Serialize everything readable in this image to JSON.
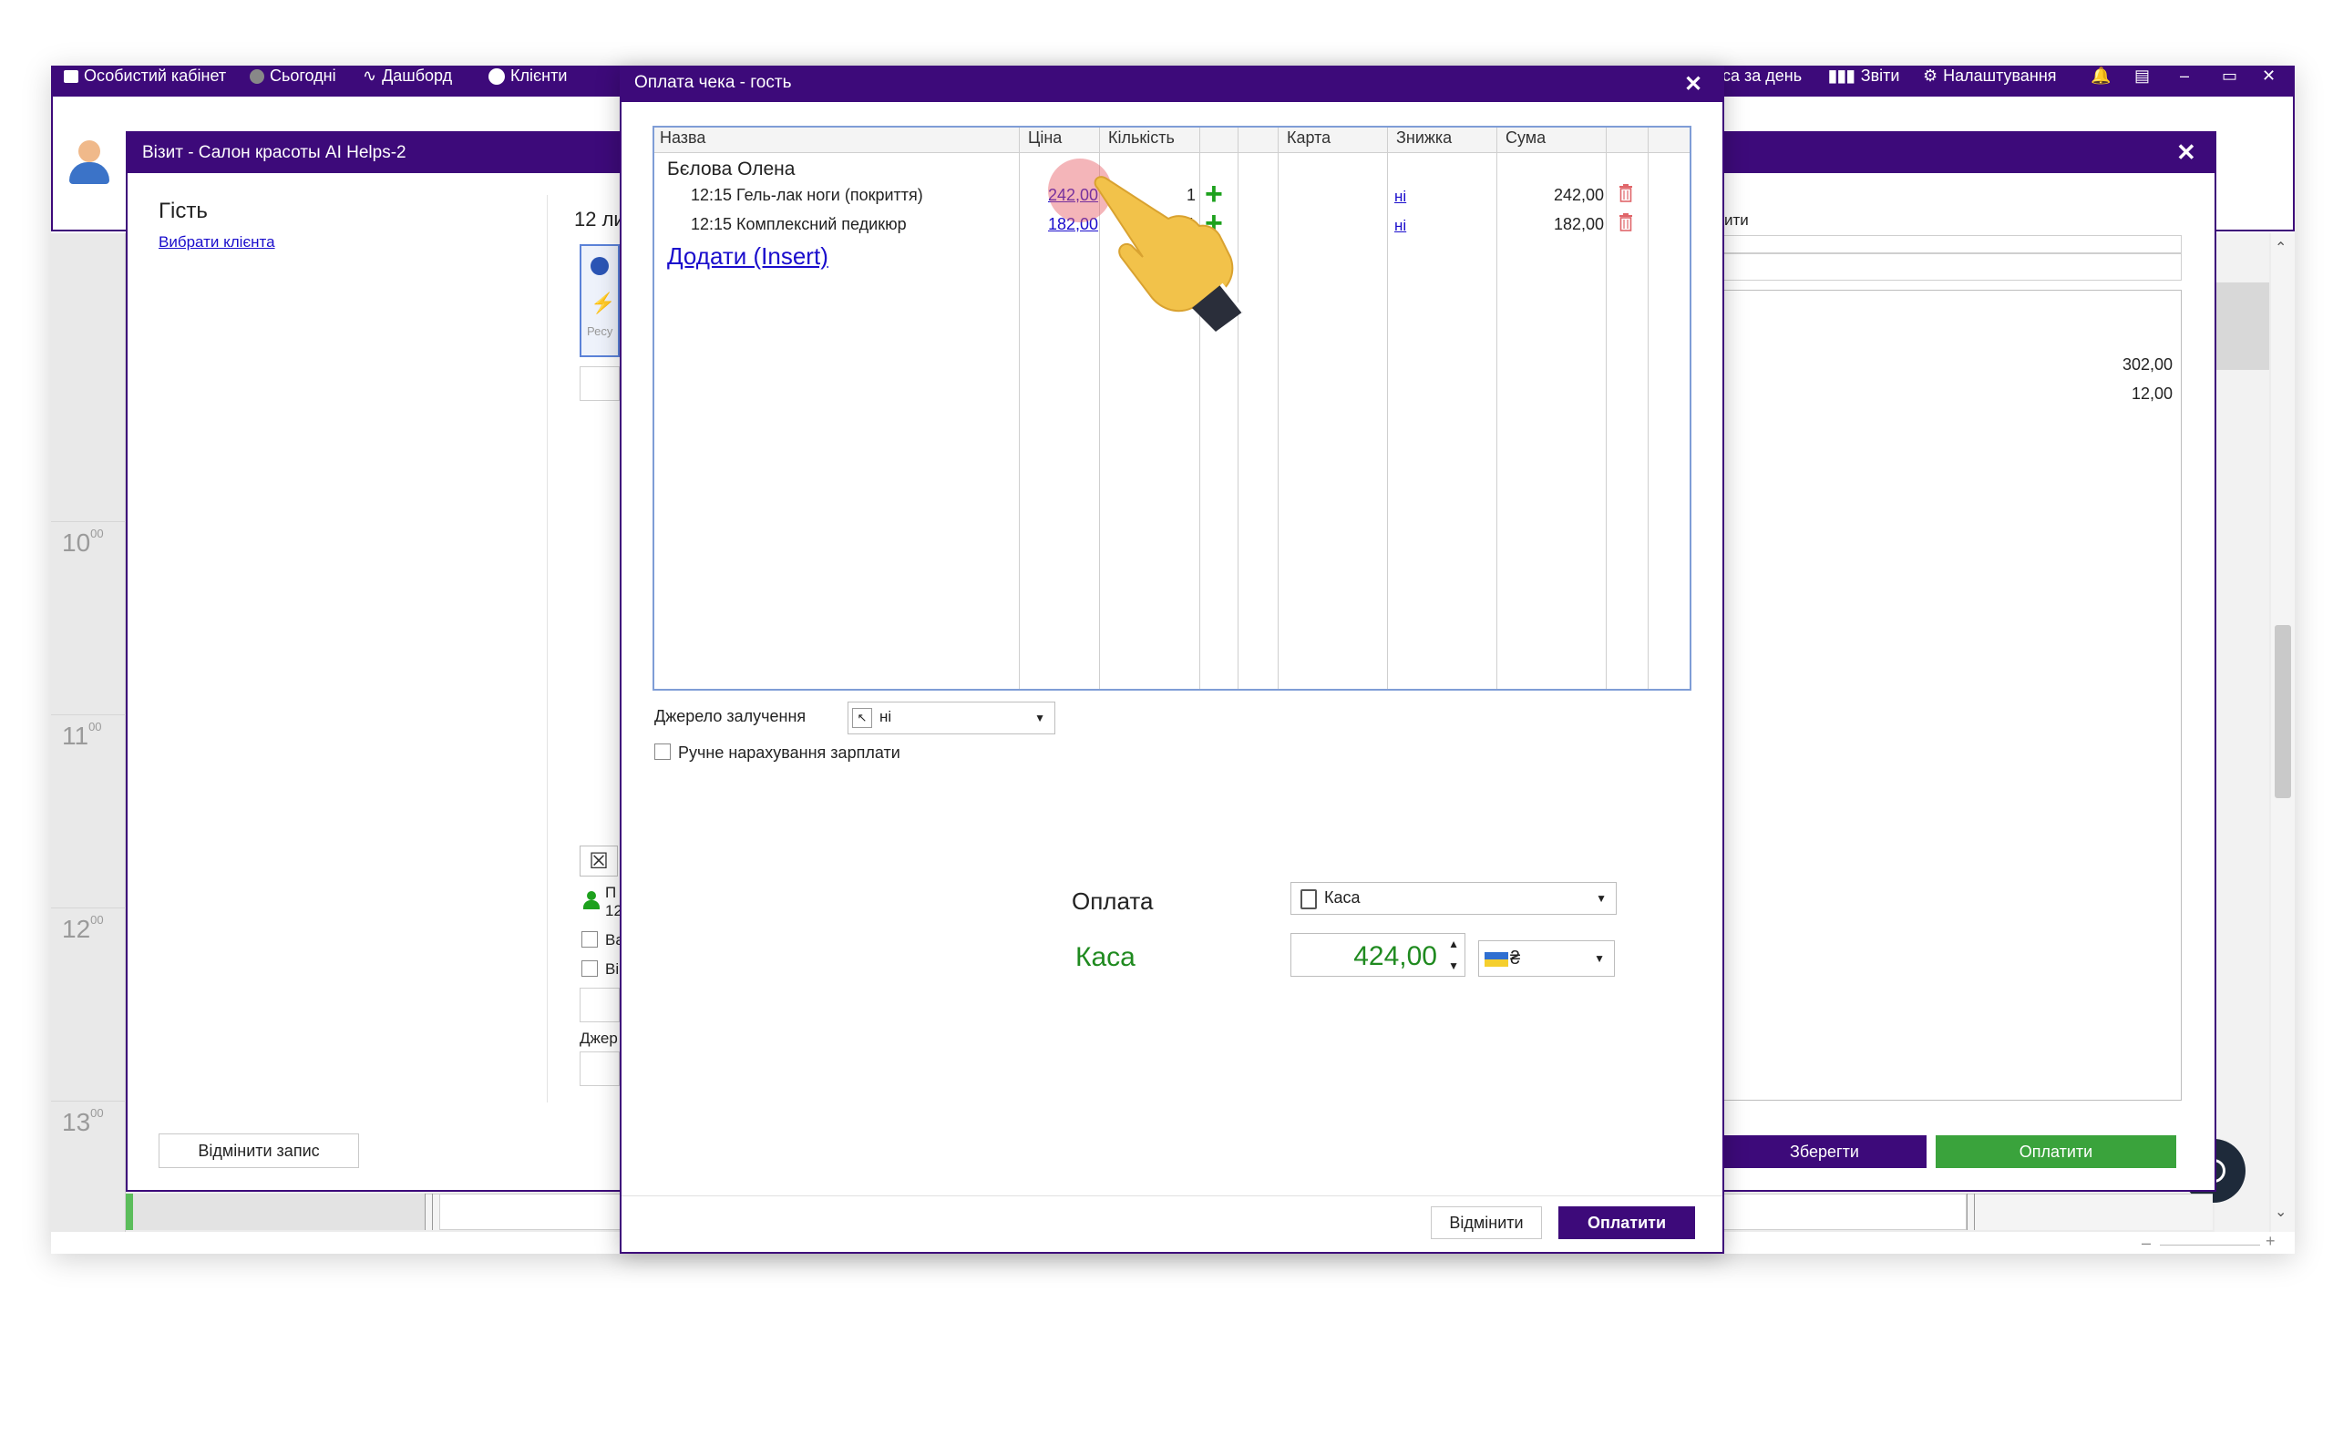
{
  "topnav": {
    "cabinet": "Особистий кабінет",
    "today": "Сьогодні",
    "dashboard": "Дашборд",
    "clients": "Клієнти",
    "day_cash": "са за день",
    "reports": "Звіти",
    "settings": "Налаштування"
  },
  "schedule": {
    "hours": [
      "10",
      "11",
      "12",
      "13"
    ],
    "minutes": "00"
  },
  "visit": {
    "title": "Візит - Салон красоты AI Helps-2",
    "guest_label": "Гість",
    "choose_client": "Вибрати клієнта",
    "date_partial": "12 ли",
    "cancel_button": "Відмінити запис",
    "save_button": "Зберегти",
    "pay_button": "Оплатити",
    "right_partial": "ити",
    "amount_1": "302,00",
    "amount_2": "12,00",
    "resource_partial": "Ресу",
    "source_partial": "Джер",
    "client_line1_partial": "П",
    "client_line2_partial": "12",
    "checkbox1_partial": "Ва",
    "checkbox2_partial": "Ві"
  },
  "dialog": {
    "title": "Оплата чека - гость",
    "columns": [
      "Назва",
      "Ціна",
      "Кількість",
      "",
      "Карта",
      "Знижка",
      "Сума"
    ],
    "client_name": "Бєлова Олена",
    "rows": [
      {
        "name": "12:15 Гель-лак ноги (покриття)",
        "price": "242,00",
        "qty": "1",
        "discount": "ні",
        "sum": "242,00"
      },
      {
        "name": "12:15 Комплексний педикюр",
        "price": "182,00",
        "qty": "1",
        "discount": "ні",
        "sum": "182,00"
      }
    ],
    "add_link": "Додати (Insert)",
    "source_label": "Джерело залучення",
    "source_value": "ні",
    "manual_salary_label": "Ручне нарахування зарплати",
    "payment_label": "Оплата",
    "payment_value": "Каса",
    "cash_label": "Каса",
    "cash_amount": "424,00",
    "currency_symbol": "₴",
    "cancel_button": "Відмінити",
    "pay_button": "Оплатити"
  },
  "colors": {
    "purple": "#3d0a7a",
    "green": "#3aa33c",
    "cash_green": "#1f8a1f",
    "link": "#1a0dcc"
  }
}
